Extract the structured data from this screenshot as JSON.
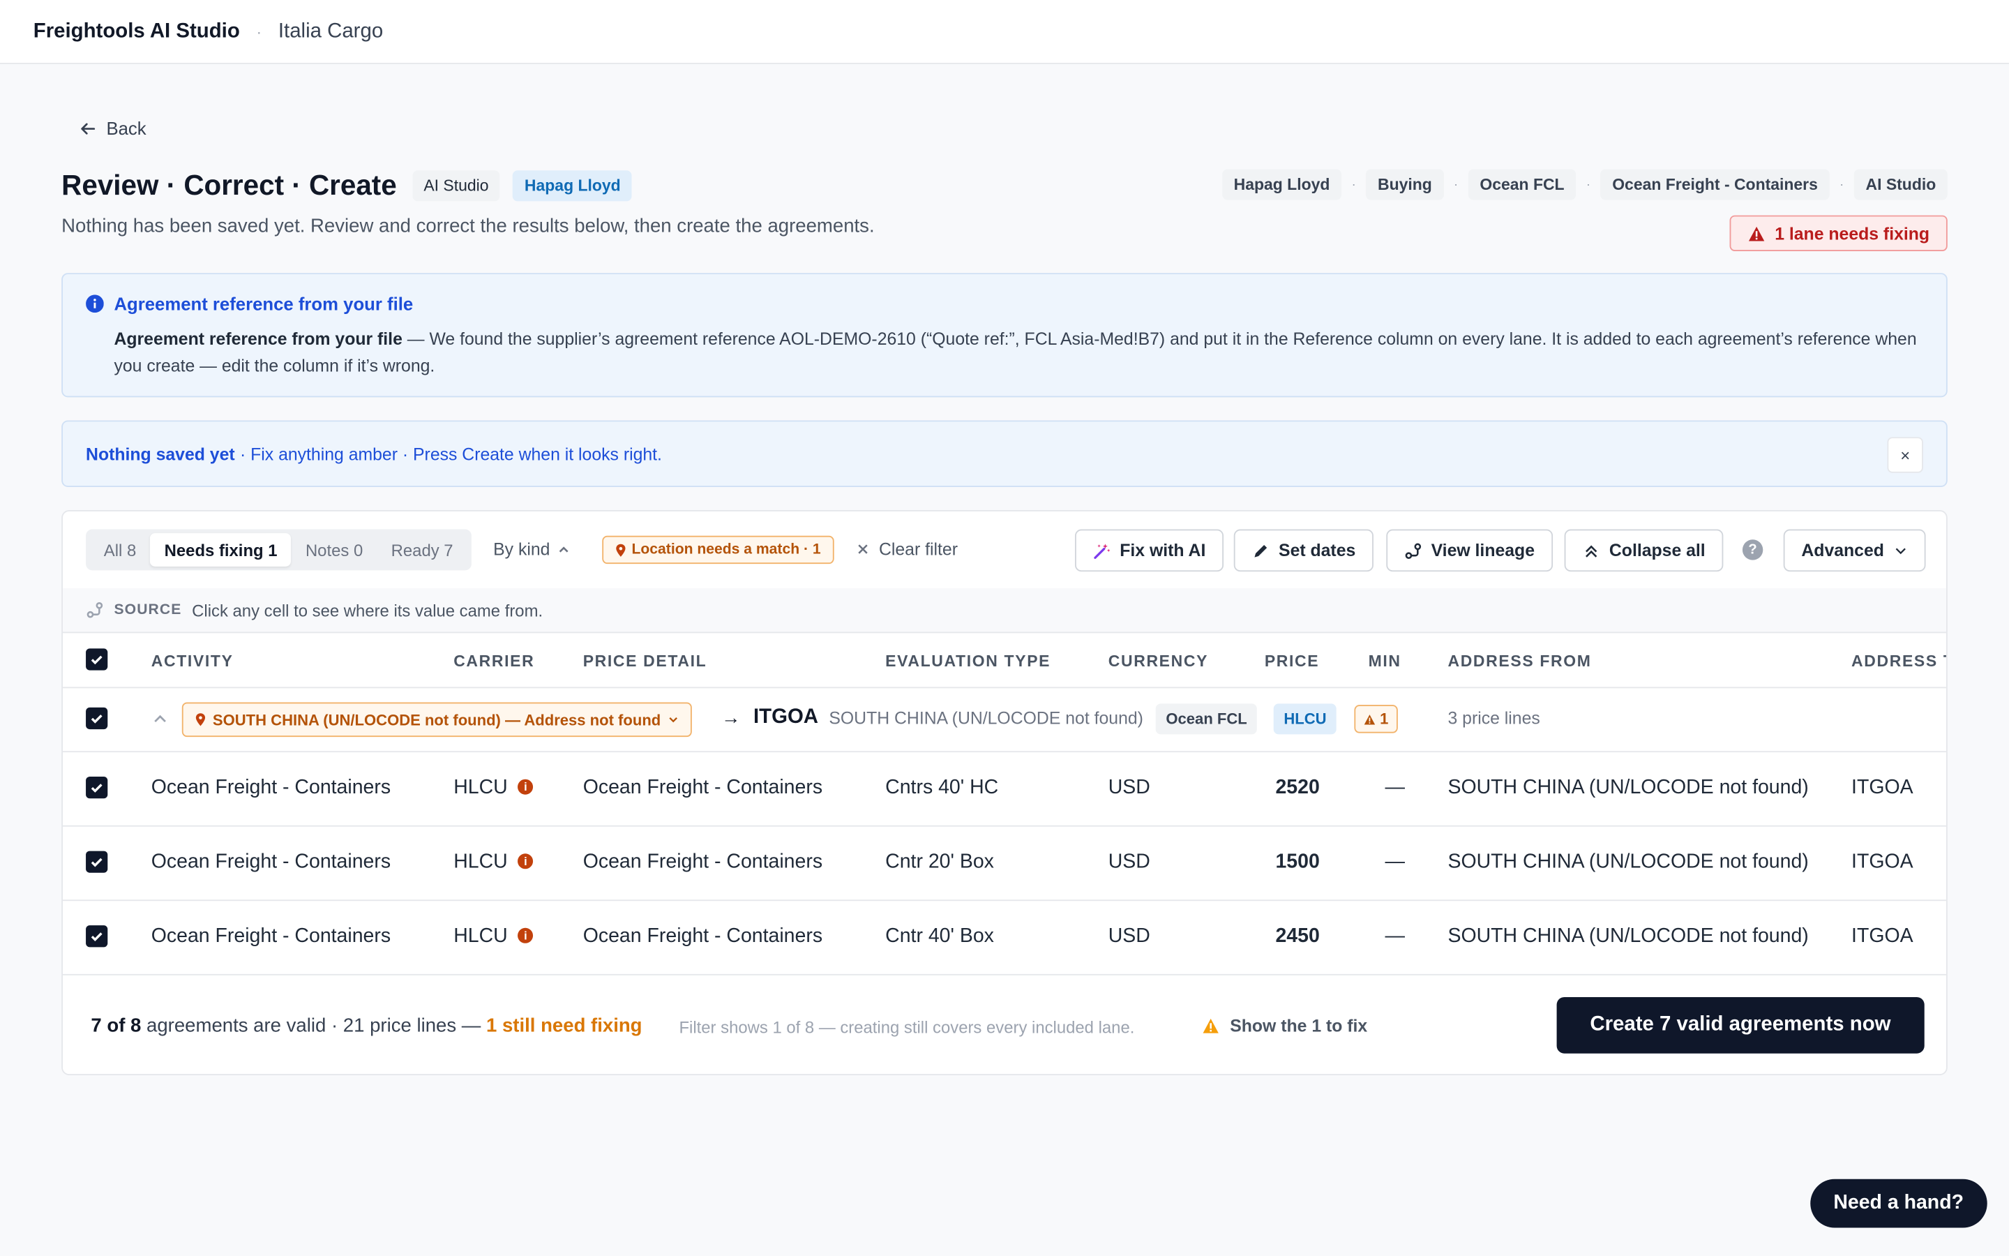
{
  "app": {
    "title": "Freightools AI Studio",
    "separator": "·",
    "org": "Italia Cargo"
  },
  "nav": {
    "back_label": "Back"
  },
  "header": {
    "title": "Review · Correct · Create",
    "chips": [
      "AI Studio",
      "Hapag Lloyd"
    ],
    "subtitle": "Nothing has been saved yet. Review and correct the results below, then create the agreements.",
    "breadcrumbs": [
      "Hapag Lloyd",
      "Buying",
      "Ocean FCL",
      "Ocean Freight - Containers",
      "AI Studio"
    ],
    "breadcrumb_sep": "·",
    "warning_badge": "1 lane needs fixing"
  },
  "info_banner": {
    "title": "Agreement reference from your file",
    "body_bold": "Agreement reference from your file",
    "body_text": " — We found the supplier’s agreement reference AOL-DEMO-2610 (“Quote ref:”, FCL Asia-Med!B7) and put it in the Reference column on every lane. It is added to each agreement’s reference when you create — edit the column if it’s wrong."
  },
  "note_banner": {
    "bold": "Nothing saved yet",
    "text": "· Fix anything amber · Press Create when it looks right.",
    "close": "×"
  },
  "toolbar": {
    "tabs": [
      "All 8",
      "Needs fixing 1",
      "Notes 0",
      "Ready 7"
    ],
    "active_tab": "Needs fixing 1",
    "by_kind": "By kind",
    "location_chip": "Location needs a match · 1",
    "clear_filter": "Clear filter",
    "fix_ai": "Fix with AI",
    "set_dates": "Set dates",
    "view_lineage": "View lineage",
    "collapse_all": "Collapse all",
    "help": "?",
    "advanced": "Advanced"
  },
  "source_row": {
    "label": "SOURCE",
    "text": "Click any cell to see where its value came from."
  },
  "table": {
    "columns": [
      "ACTIVITY",
      "CARRIER",
      "PRICE DETAIL",
      "EVALUATION TYPE",
      "CURRENCY",
      "PRICE",
      "MIN",
      "ADDRESS FROM",
      "ADDRESS T"
    ],
    "group": {
      "address_chip": "SOUTH CHINA (UN/LOCODE not found) — Address not found",
      "arrow": "→",
      "destination": "ITGOA",
      "origin_text": "SOUTH CHINA (UN/LOCODE not found)",
      "mode_chip": "Ocean FCL",
      "carrier_chip": "HLCU",
      "warn_count": "1",
      "price_lines": "3 price lines"
    },
    "rows": [
      {
        "activity": "Ocean Freight - Containers",
        "carrier": "HLCU",
        "price_detail": "Ocean Freight - Containers",
        "evaluation": "Cntrs 40' HC",
        "currency": "USD",
        "price": "2520",
        "min": "—",
        "from": "SOUTH CHINA (UN/LOCODE not found)",
        "to": "ITGOA"
      },
      {
        "activity": "Ocean Freight - Containers",
        "carrier": "HLCU",
        "price_detail": "Ocean Freight - Containers",
        "evaluation": "Cntr 20' Box",
        "currency": "USD",
        "price": "1500",
        "min": "—",
        "from": "SOUTH CHINA (UN/LOCODE not found)",
        "to": "ITGOA"
      },
      {
        "activity": "Ocean Freight - Containers",
        "carrier": "HLCU",
        "price_detail": "Ocean Freight - Containers",
        "evaluation": "Cntr 40' Box",
        "currency": "USD",
        "price": "2450",
        "min": "—",
        "from": "SOUTH CHINA (UN/LOCODE not found)",
        "to": "ITGOA"
      }
    ]
  },
  "footer": {
    "valid_count": "7 of 8",
    "summary_text": " agreements are valid · 21 price lines — ",
    "need_fix": "1 still need fixing",
    "filter_note": "Filter shows 1 of 8 — creating still covers every included lane.",
    "show_fix": "Show the 1 to fix",
    "create_button": "Create 7 valid agreements now"
  },
  "help_button": "Need a hand?",
  "colors": {
    "accent_dark": "#0f172a",
    "amber": "#d97706",
    "info_blue": "#1d4ed8",
    "danger": "#b91c1c"
  }
}
